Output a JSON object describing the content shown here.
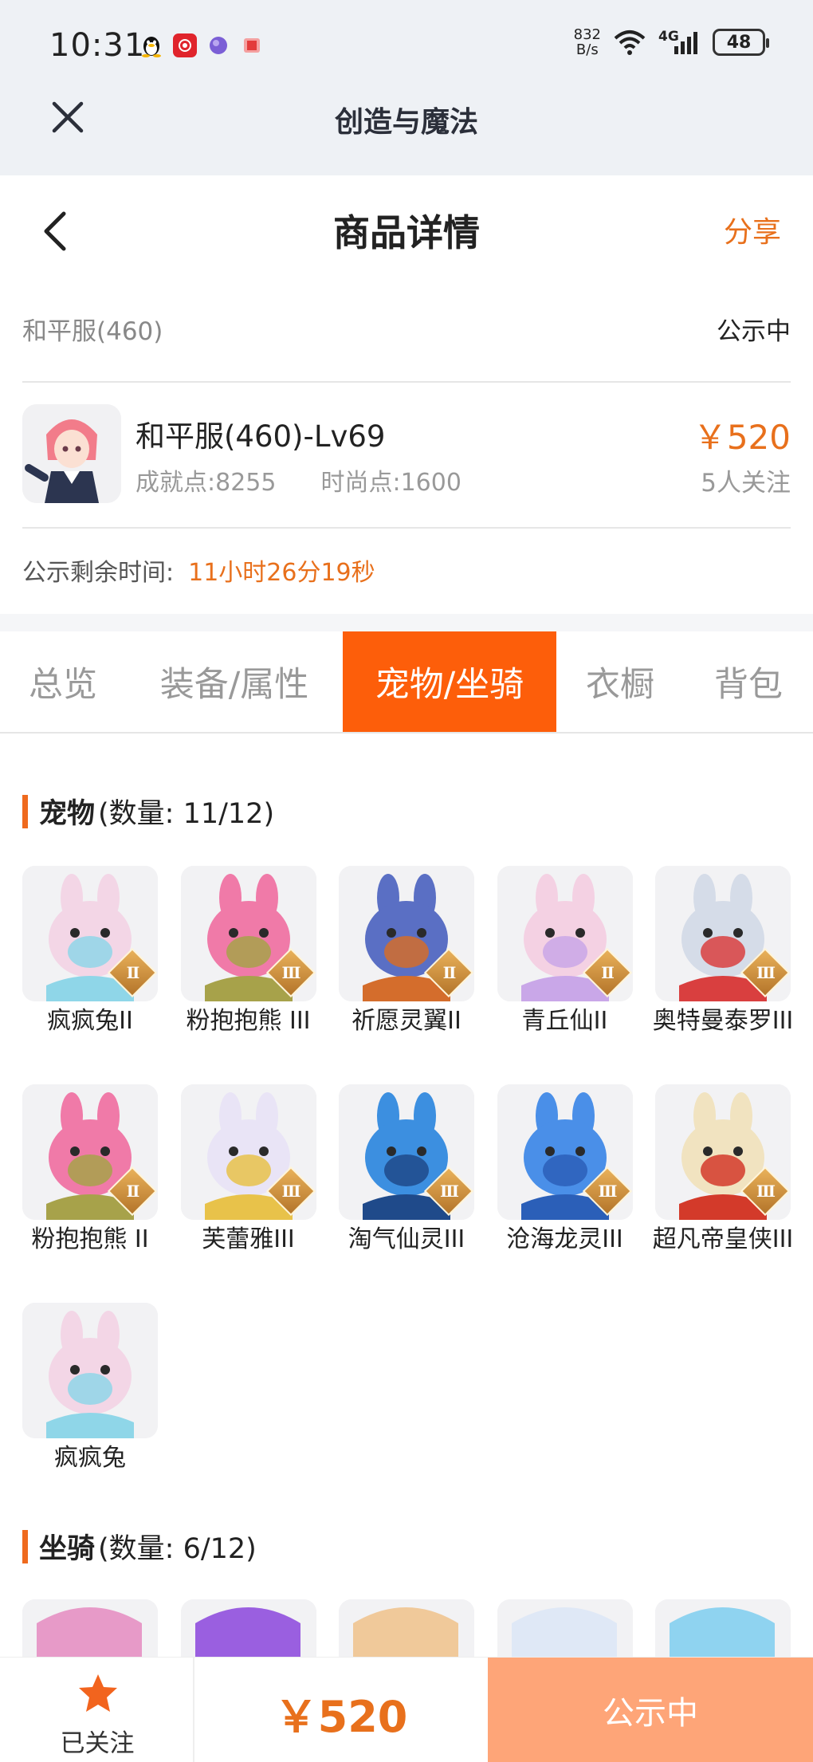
{
  "status_bar": {
    "time": "10:31",
    "net_speed_value": "832",
    "net_speed_unit": "B/s",
    "network": "4G",
    "battery": "48"
  },
  "app_bar": {
    "title": "创造与魔法"
  },
  "header": {
    "title": "商品详情",
    "share_label": "分享"
  },
  "listing": {
    "server": "和平服(460)",
    "status": "公示中",
    "item_title": "和平服(460)-Lv69",
    "achievement": "成就点:8255",
    "fashion": "时尚点:1600",
    "price": "￥520",
    "watchers": "5人关注",
    "remaining_label": "公示剩余时间:",
    "remaining_value": "11小时26分19秒"
  },
  "tabs": [
    {
      "label": "总览",
      "active": false
    },
    {
      "label": "装备/属性",
      "active": false
    },
    {
      "label": "宠物/坐骑",
      "active": true
    },
    {
      "label": "衣橱",
      "active": false
    },
    {
      "label": "背包",
      "active": false
    }
  ],
  "pets": {
    "title": "宠物",
    "count": "(数量: 11/12)",
    "items": [
      {
        "name": "疯疯兔II",
        "badge": "II",
        "color": "#f3d6e6",
        "accent": "#8fd6e8"
      },
      {
        "name": "粉抱抱熊 III",
        "badge": "III",
        "color": "#f07aa8",
        "accent": "#a7a24a"
      },
      {
        "name": "祈愿灵翼II",
        "badge": "II",
        "color": "#5a6fc4",
        "accent": "#d46d2c"
      },
      {
        "name": "青丘仙II",
        "badge": "II",
        "color": "#f4d1e3",
        "accent": "#c9a7e8"
      },
      {
        "name": "奥特曼泰罗III",
        "badge": "III",
        "color": "#d5dce8",
        "accent": "#d93f3f"
      },
      {
        "name": "粉抱抱熊 II",
        "badge": "II",
        "color": "#f07aa8",
        "accent": "#a7a24a"
      },
      {
        "name": "芙蕾雅III",
        "badge": "III",
        "color": "#e9e4f6",
        "accent": "#e8c24a"
      },
      {
        "name": "淘气仙灵III",
        "badge": "III",
        "color": "#3c8fe0",
        "accent": "#1f4a8a"
      },
      {
        "name": "沧海龙灵III",
        "badge": "III",
        "color": "#4a8fe8",
        "accent": "#2b5fb8"
      },
      {
        "name": "超凡帝皇侠III",
        "badge": "III",
        "color": "#f1e3c0",
        "accent": "#d33a2a"
      },
      {
        "name": "疯疯兔",
        "badge": "",
        "color": "#f3d6e6",
        "accent": "#8fd6e8"
      }
    ]
  },
  "mounts": {
    "title": "坐骑",
    "count": "(数量: 6/12)",
    "items": [
      {
        "color": "#e79ac8"
      },
      {
        "color": "#9a5fe0"
      },
      {
        "color": "#f0c99a"
      },
      {
        "color": "#dfe8f6"
      },
      {
        "color": "#8fd3f0"
      }
    ]
  },
  "bottom_bar": {
    "follow_label": "已关注",
    "price": "￥520",
    "status_label": "公示中"
  }
}
